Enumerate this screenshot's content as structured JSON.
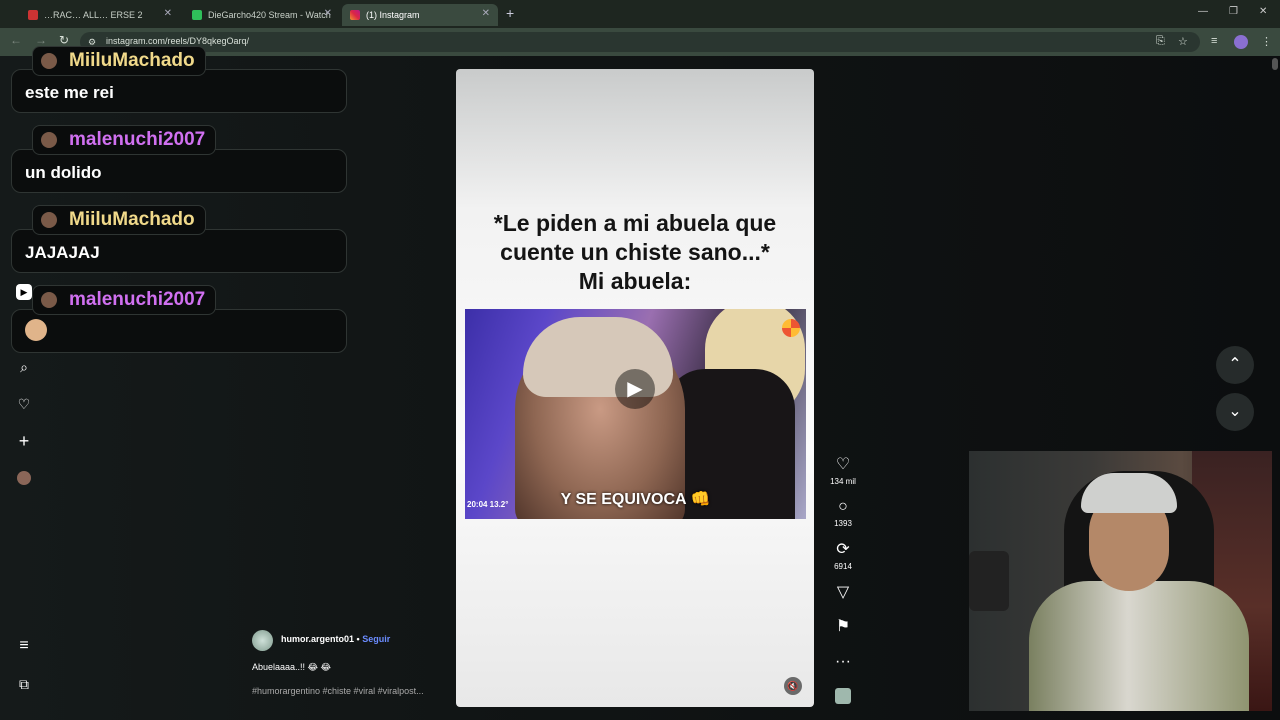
{
  "browser": {
    "tabs": [
      {
        "label": "…RAC… ALL… ERSE 2"
      },
      {
        "label": "DieGarcho420 Stream - Watch"
      },
      {
        "label": "(1) Instagram"
      }
    ],
    "url": "instagram.com/reels/DY8qkegOarq/"
  },
  "chat": {
    "messages": [
      {
        "user": "MiiluMachado",
        "text": "este me rei"
      },
      {
        "user": "malenuchi2007",
        "text": "un dolido"
      },
      {
        "user": "MiiluMachado",
        "text": "JAJAJAJ"
      },
      {
        "user": "malenuchi2007",
        "text": ""
      }
    ]
  },
  "reel": {
    "caption_lines": [
      "*Le piden a mi abuela que",
      "cuente un chiste sano...*",
      "Mi abuela:"
    ],
    "subtitle": "Y SE EQUIVOCA 👊",
    "timestamp": "20:04   13.2°",
    "actions": {
      "likes": "134 mil",
      "comments": "1393",
      "reposts": "6914"
    },
    "author": "humor.argento01",
    "follow": "Seguir",
    "post_caption": "Abuelaaaa..!! 😂 😂",
    "hashtags": "#humorargentino #chiste #viral #viralpost..."
  },
  "icons": [
    "home-icon",
    "reels-icon",
    "explore-icon",
    "search-icon",
    "heart-icon",
    "plus-icon",
    "menu-icon",
    "apps-icon"
  ],
  "colors": {
    "follow": "#6b8cff",
    "user_yellow": "#f0d98a",
    "user_pink": "#d070f0"
  }
}
